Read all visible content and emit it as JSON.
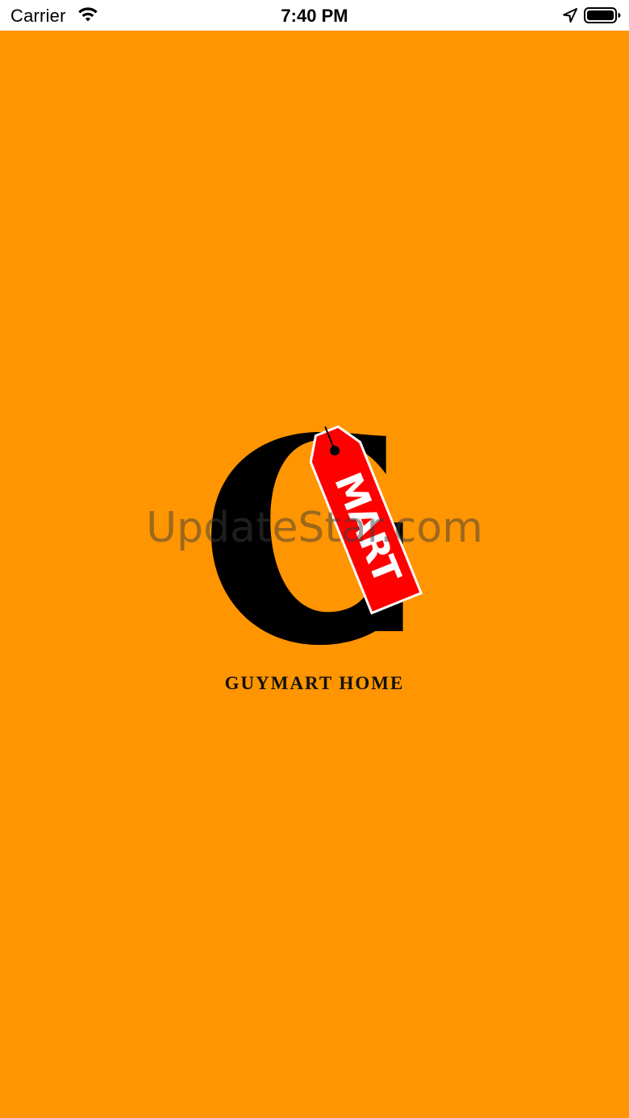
{
  "status_bar": {
    "carrier": "Carrier",
    "time": "7:40 PM",
    "icons": [
      "wifi-icon",
      "location-arrow-icon",
      "battery-icon"
    ]
  },
  "splash": {
    "background_color": "#ff9500",
    "logo": {
      "letter": "G",
      "tag_text": "MART",
      "tag_color": "#ff0000",
      "letter_color": "#000000"
    },
    "brand_name": "GUYMART HOME"
  },
  "watermark": "UpdateStar.com"
}
